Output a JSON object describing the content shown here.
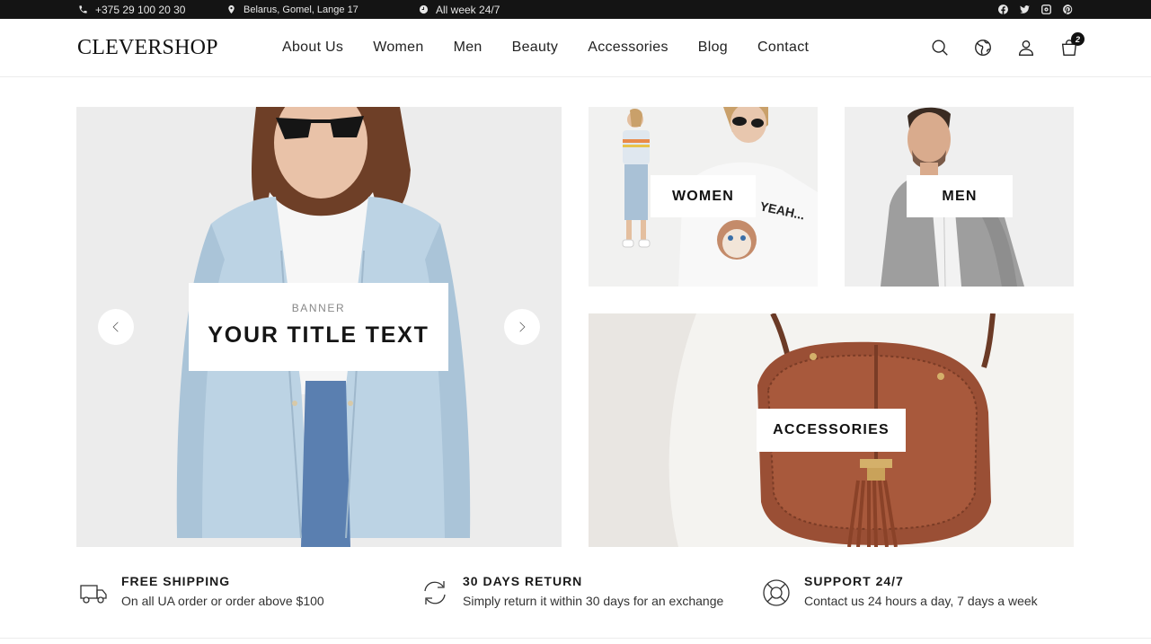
{
  "topbar": {
    "phone": "+375 29 100 20 30",
    "address": "Belarus, Gomel, Lange 17",
    "hours": "All week 24/7",
    "socials": [
      "facebook-icon",
      "twitter-icon",
      "instagram-icon",
      "pinterest-icon"
    ]
  },
  "header": {
    "logo": "CLEVERSHOP",
    "nav": [
      "About Us",
      "Women",
      "Men",
      "Beauty",
      "Accessories",
      "Blog",
      "Contact"
    ],
    "cart_count": "2",
    "icons": [
      "search-icon",
      "globe-icon",
      "user-icon",
      "cart-icon"
    ]
  },
  "hero": {
    "small": "BANNER",
    "title": "YOUR TITLE TEXT"
  },
  "categories": {
    "women": "WOMEN",
    "men": "MEN",
    "accessories": "ACCESSORIES"
  },
  "features": [
    {
      "title": "FREE SHIPPING",
      "desc": "On all UA order or order above $100",
      "icon": "truck-icon"
    },
    {
      "title": "30 DAYS RETURN",
      "desc": "Simply return it within 30 days for an exchange",
      "icon": "refresh-icon"
    },
    {
      "title": "SUPPORT 24/7",
      "desc": "Contact us 24 hours a day, 7 days a week",
      "icon": "lifebuoy-icon"
    }
  ],
  "colors": {
    "topbar_bg": "#141414",
    "text": "#1a1a1a",
    "accent_bag": "#8a4a32"
  }
}
